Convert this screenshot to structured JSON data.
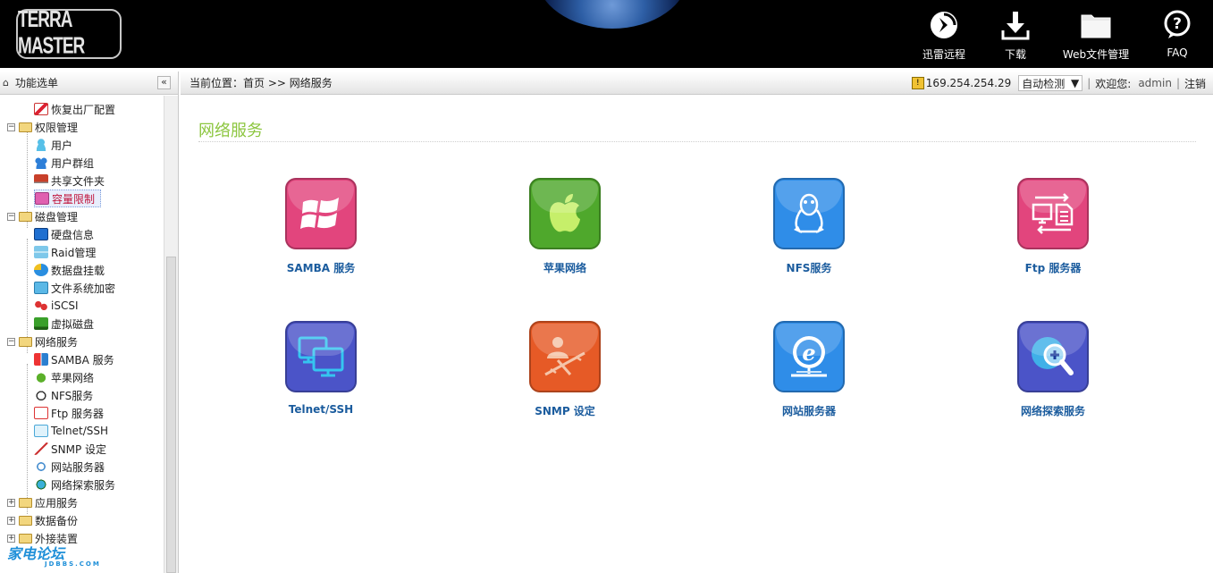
{
  "header": {
    "logo_text": "TERRA MASTER",
    "nav": [
      {
        "label": "迅雷远程",
        "icon": "remote-download-icon"
      },
      {
        "label": "下载",
        "icon": "download-icon"
      },
      {
        "label": "Web文件管理",
        "icon": "folder-icon"
      },
      {
        "label": "FAQ",
        "icon": "help-icon"
      }
    ]
  },
  "sidebar": {
    "title": "功能选单",
    "collapse_label": "«",
    "items": [
      {
        "label": "恢复出厂配置",
        "type": "child"
      },
      {
        "label": "权限管理",
        "type": "group",
        "expanded": true
      },
      {
        "label": "用户",
        "type": "child"
      },
      {
        "label": "用户群组",
        "type": "child"
      },
      {
        "label": "共享文件夹",
        "type": "child"
      },
      {
        "label": "容量限制",
        "type": "child",
        "active": true
      },
      {
        "label": "磁盘管理",
        "type": "group",
        "expanded": true
      },
      {
        "label": "硬盘信息",
        "type": "child"
      },
      {
        "label": "Raid管理",
        "type": "child"
      },
      {
        "label": "数据盘挂载",
        "type": "child"
      },
      {
        "label": "文件系统加密",
        "type": "child"
      },
      {
        "label": "iSCSI",
        "type": "child"
      },
      {
        "label": "虚拟磁盘",
        "type": "child"
      },
      {
        "label": "网络服务",
        "type": "group",
        "expanded": true
      },
      {
        "label": "SAMBA 服务",
        "type": "child"
      },
      {
        "label": "苹果网络",
        "type": "child"
      },
      {
        "label": "NFS服务",
        "type": "child"
      },
      {
        "label": "Ftp 服务器",
        "type": "child"
      },
      {
        "label": "Telnet/SSH",
        "type": "child"
      },
      {
        "label": "SNMP 设定",
        "type": "child"
      },
      {
        "label": "网站服务器",
        "type": "child"
      },
      {
        "label": "网络探索服务",
        "type": "child"
      },
      {
        "label": "应用服务",
        "type": "group",
        "expanded": false
      },
      {
        "label": "数据备份",
        "type": "group",
        "expanded": false
      },
      {
        "label": "外接装置",
        "type": "group",
        "expanded": false
      }
    ]
  },
  "breadcrumb": {
    "text": "当前位置：首页 >> 网络服务",
    "ip": "169.254.254.29",
    "language": "自动检测",
    "welcome": "欢迎您:",
    "user": "admin",
    "logout": "注销"
  },
  "main": {
    "title": "网络服务",
    "tiles": [
      {
        "label": "SAMBA 服务",
        "icon": "windows-icon",
        "color": "#e2457d"
      },
      {
        "label": "苹果网络",
        "icon": "apple-icon",
        "color": "#4fa82c"
      },
      {
        "label": "NFS服务",
        "icon": "penguin-icon",
        "color": "#2f8de8"
      },
      {
        "label": "Ftp 服务器",
        "icon": "ftp-transfer-icon",
        "color": "#e2457d"
      },
      {
        "label": "Telnet/SSH",
        "icon": "monitors-icon",
        "color": "#4b54c8"
      },
      {
        "label": "SNMP 设定",
        "icon": "snmp-network-icon",
        "color": "#e65a26"
      },
      {
        "label": "网站服务器",
        "icon": "web-server-icon",
        "color": "#2f8de8"
      },
      {
        "label": "网络探索服务",
        "icon": "network-search-icon",
        "color": "#4b54c8"
      }
    ]
  },
  "watermark": {
    "text": "家电论坛",
    "sub": "JDBBS.COM"
  }
}
